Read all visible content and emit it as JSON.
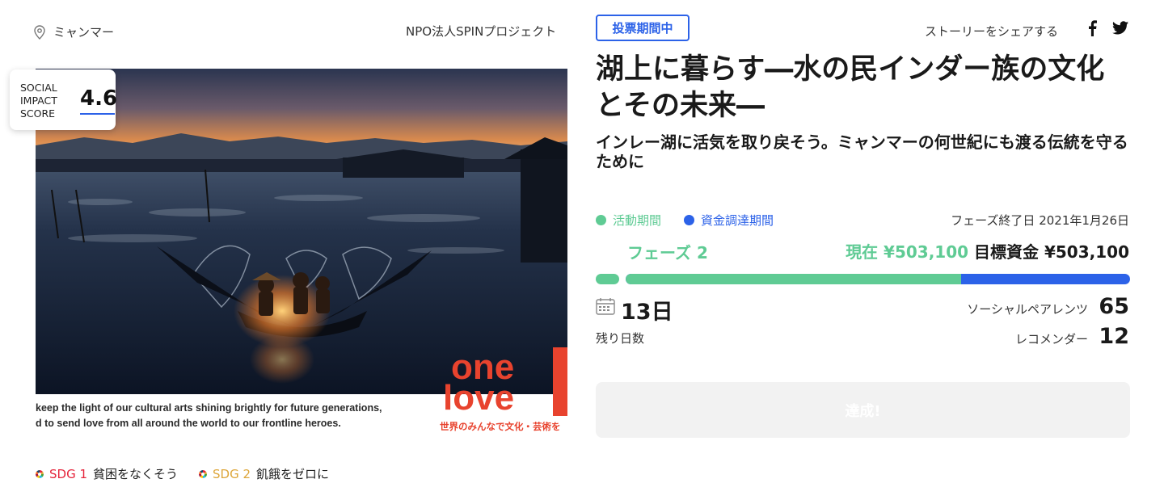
{
  "location": {
    "text": "ミャンマー",
    "icon": "map-pin-icon"
  },
  "organization": "NPO法人SPINプロジェクト",
  "score": {
    "label_lines": [
      "SOCIAL",
      "IMPACT",
      "SCORE"
    ],
    "value": "4.6"
  },
  "hero": {
    "caption_line1": "keep the light of our cultural arts shining brightly for future generations,",
    "caption_line2": "d to send love from all around the world to our frontline heroes.",
    "logo_word1": "one",
    "logo_word2": "love",
    "logo_tagline": "世界のみんなで文化・芸術を",
    "logo_color": "#e8432e"
  },
  "sdgs": [
    {
      "code": "SDG 1",
      "text": "貧困をなくそう",
      "color": "#e5243b"
    },
    {
      "code": "SDG 2",
      "text": "飢餓をゼロに",
      "color": "#dda63a"
    }
  ],
  "vote_badge": "投票期間中",
  "share": {
    "label": "ストーリーをシェアする",
    "icons": [
      "facebook-icon",
      "twitter-icon"
    ]
  },
  "title": "湖上に暮らす―水の民インダー族の文化とその未来―",
  "subtitle": "インレー湖に活気を取り戻そう。ミャンマーの何世紀にも渡る伝統を守るために",
  "legend": [
    {
      "label": "活動期間",
      "color": "#5fcb94"
    },
    {
      "label": "資金調達期間",
      "color": "#2c62e8"
    }
  ],
  "phase_end": "フェーズ終了日 2021年1月26日",
  "phase_name": "フェーズ 2",
  "funding": {
    "current": "現在 ¥503,100",
    "goal": "目標資金 ¥503,100"
  },
  "progress": {
    "activity_fraction": 0.665
  },
  "days_left": {
    "value": "13日",
    "label": "残り日数",
    "icon": "calendar-icon"
  },
  "stats": {
    "social_parents": {
      "label": "ソーシャルペアレンツ",
      "value": "65"
    },
    "recommenders": {
      "label": "レコメンダー",
      "value": "12"
    }
  },
  "achieve_button": "達成!",
  "colors": {
    "accent_blue": "#2c62e8",
    "accent_green": "#5fcb94"
  }
}
